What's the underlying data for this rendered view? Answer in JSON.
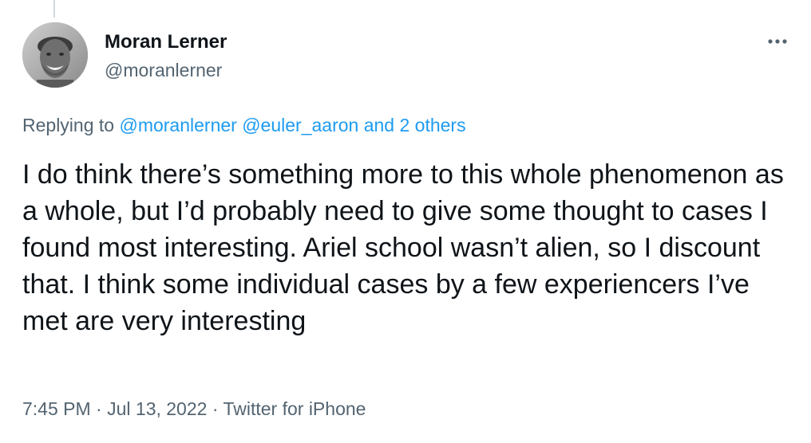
{
  "author": {
    "name": "Moran Lerner",
    "handle": "@moranlerner",
    "avatar_icon": "profile-photo"
  },
  "more_icon": "more-options-icon",
  "reply": {
    "prefix": "Replying to ",
    "mentions": [
      "@moranlerner",
      "@euler_aaron"
    ],
    "others": "and 2 others"
  },
  "tweet": {
    "text": "I do think there’s something more to this whole phenomenon as a whole, but I’d probably need to give some thought to cases I found most interesting. Ariel school wasn’t alien, so I discount that. I think some individual cases by a few experiencers I’ve met are very interesting"
  },
  "meta": {
    "time": "7:45 PM",
    "separator": " · ",
    "date": "Jul 13, 2022",
    "source": "Twitter for iPhone"
  },
  "colors": {
    "text": "#0f1419",
    "secondary": "#536471",
    "link": "#1d9bf0"
  }
}
